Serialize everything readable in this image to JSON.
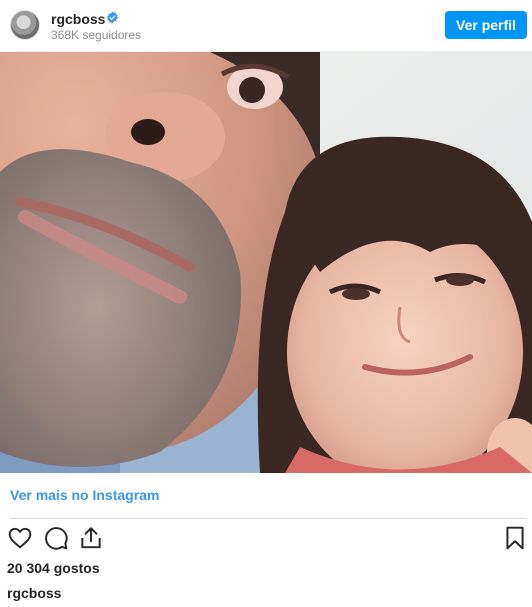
{
  "header": {
    "username": "rgcboss",
    "followers": "368K seguidores",
    "follow_label": "Ver perfil",
    "verified_icon": "verified-badge-icon",
    "colors": {
      "button": "#0095f6",
      "verified": "#3897f0"
    }
  },
  "post": {
    "image_alt": "Selfie of a bearded man and a smiling young girl",
    "more_link": "Ver mais no Instagram",
    "likes": "20 304 gostos",
    "caption_username": "rgcboss"
  },
  "actions": {
    "like_icon": "heart-icon",
    "comment_icon": "comment-icon",
    "share_icon": "share-icon",
    "save_icon": "bookmark-icon"
  }
}
